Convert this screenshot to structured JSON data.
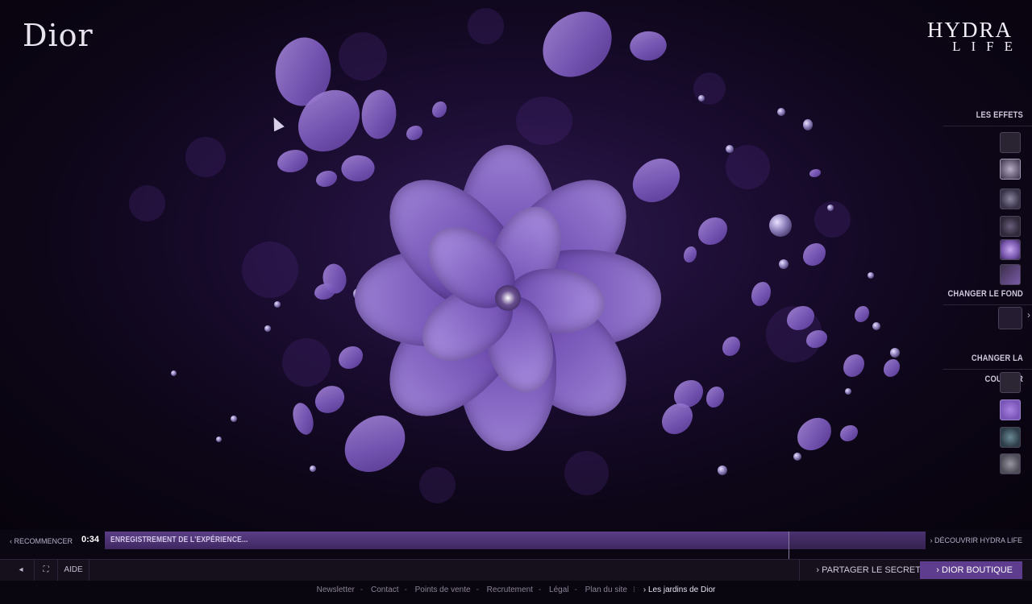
{
  "brand": {
    "logo": "Dior",
    "product_line1": "HYDRA",
    "product_line2": "LIFE"
  },
  "panel": {
    "effects_title": "LES EFFETS",
    "background_title": "CHANGER LE FOND",
    "color_title": "CHANGER LA COULEUR",
    "prev_arrow": "‹",
    "next_arrow": "›"
  },
  "recording": {
    "restart_label": "‹ RECOMMENCER",
    "time": "0:34",
    "status_label": "ENREGISTREMENT DE L'EXPÉRIENCE...",
    "progress": 0.833,
    "discover_label": "› DÉCOUVRIR HYDRA LIFE"
  },
  "controls": {
    "sound_icon": "◂",
    "fullscreen_icon": "⛶",
    "help_label": "AIDE",
    "share_label": "› PARTAGER LE SECRET",
    "boutique_label": "› DIOR BOUTIQUE"
  },
  "footer": {
    "links": [
      "Newsletter",
      "Contact",
      "Points de vente",
      "Recrutement",
      "Légal",
      "Plan du site"
    ],
    "highlight": "› Les jardins de Dior",
    "separator": "-",
    "divider": "⁝"
  },
  "colors": {
    "accent": "#5e3d8f",
    "petal": "#8a6ac8",
    "background": "#0a0510"
  }
}
